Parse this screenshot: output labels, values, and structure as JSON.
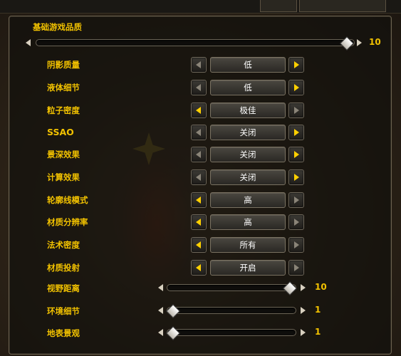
{
  "section_title": "基础游戏品质",
  "main_slider": {
    "value": "10",
    "level": 1.0
  },
  "dropdown_rows": [
    {
      "label": "阴影质量",
      "value": "低",
      "left_active": false,
      "right_active": true
    },
    {
      "label": "液体细节",
      "value": "低",
      "left_active": false,
      "right_active": true
    },
    {
      "label": "粒子密度",
      "value": "极佳",
      "left_active": true,
      "right_active": false
    },
    {
      "label": "SSAO",
      "value": "关闭",
      "left_active": false,
      "right_active": true
    },
    {
      "label": "景深效果",
      "value": "关闭",
      "left_active": false,
      "right_active": true
    },
    {
      "label": "计算效果",
      "value": "关闭",
      "left_active": false,
      "right_active": true
    },
    {
      "label": "轮廓线模式",
      "value": "高",
      "left_active": true,
      "right_active": false
    },
    {
      "label": "材质分辨率",
      "value": "高",
      "left_active": true,
      "right_active": false
    },
    {
      "label": "法术密度",
      "value": "所有",
      "left_active": true,
      "right_active": false
    },
    {
      "label": "材质投射",
      "value": "开启",
      "left_active": true,
      "right_active": false
    }
  ],
  "slider_rows": [
    {
      "label": "视野距离",
      "value": "10",
      "level": 1.0
    },
    {
      "label": "环境细节",
      "value": "1",
      "level": 0.0
    },
    {
      "label": "地表景观",
      "value": "1",
      "level": 0.0
    }
  ]
}
